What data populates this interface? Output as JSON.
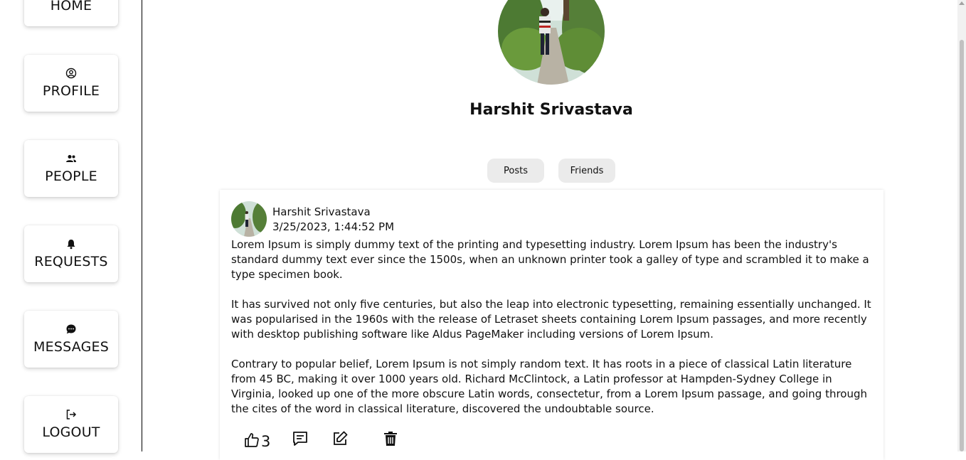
{
  "sidebar": {
    "items": [
      {
        "label": "HOME",
        "icon": "home-icon"
      },
      {
        "label": "PROFILE",
        "icon": "user-circle-icon"
      },
      {
        "label": "PEOPLE",
        "icon": "people-icon"
      },
      {
        "label": "REQUESTS",
        "icon": "bell-icon"
      },
      {
        "label": "MESSAGES",
        "icon": "chat-bubble-icon"
      },
      {
        "label": "LOGOUT",
        "icon": "logout-icon"
      }
    ]
  },
  "profile": {
    "name": "Harshit Srivastava"
  },
  "tabs": [
    {
      "label": "Posts"
    },
    {
      "label": "Friends"
    }
  ],
  "post": {
    "author": "Harshit Srivastava",
    "date": "3/25/2023, 1:44:52 PM",
    "paragraphs": [
      "Lorem Ipsum is simply dummy text of the printing and typesetting industry. Lorem Ipsum has been the industry's standard dummy text ever since the 1500s, when an unknown printer took a galley of type and scrambled it to make a type specimen book.",
      "It has survived not only five centuries, but also the leap into electronic typesetting, remaining essentially unchanged. It was popularised in the 1960s with the release of Letraset sheets containing Lorem Ipsum passages, and more recently with desktop publishing software like Aldus PageMaker including versions of Lorem Ipsum.",
      "Contrary to popular belief, Lorem Ipsum is not simply random text. It has roots in a piece of classical Latin literature from 45 BC, making it over 1000 years old. Richard McClintock, a Latin professor at Hampden-Sydney College in Virginia, looked up one of the more obscure Latin words, consectetur, from a Lorem Ipsum passage, and going through the cites of the word in classical literature, discovered the undoubtable source."
    ],
    "like_count": "3",
    "actions": [
      "thumbs-up-icon",
      "comment-icon",
      "edit-icon",
      "trash-icon"
    ]
  },
  "colors": {
    "tab_bg": "#ebebeb",
    "sidebar_border": "#000000"
  }
}
